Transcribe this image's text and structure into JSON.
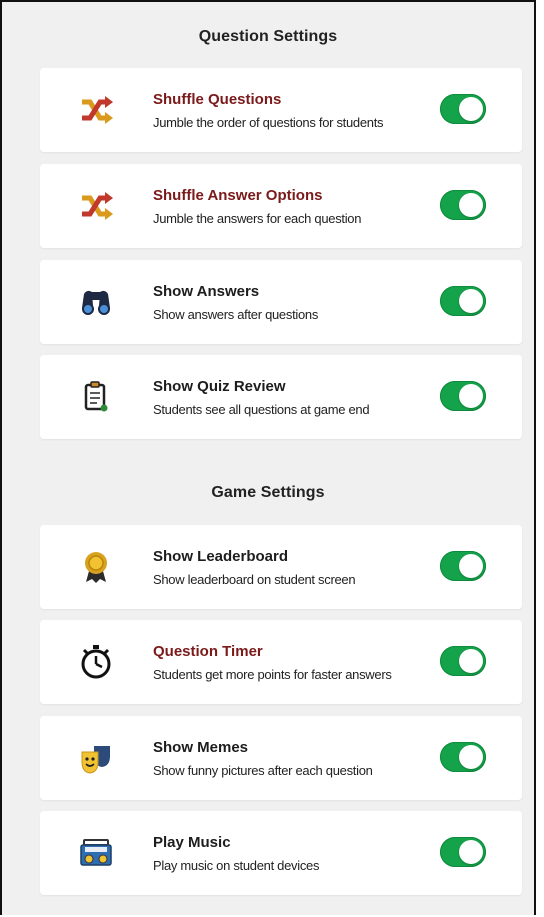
{
  "question_settings": {
    "title": "Question Settings",
    "items": [
      {
        "icon": "shuffle-icon",
        "title": "Shuffle Questions",
        "description": "Jumble the order of questions for students",
        "enabled": true
      },
      {
        "icon": "shuffle-icon",
        "title": "Shuffle Answer Options",
        "description": "Jumble the answers for each question",
        "enabled": true
      },
      {
        "icon": "binoculars-icon",
        "title": "Show Answers",
        "description": "Show answers after questions",
        "enabled": true
      },
      {
        "icon": "clipboard-icon",
        "title": "Show Quiz Review",
        "description": "Students see all questions at game end",
        "enabled": true
      }
    ]
  },
  "game_settings": {
    "title": "Game Settings",
    "items": [
      {
        "icon": "medal-icon",
        "title": "Show Leaderboard",
        "description": "Show leaderboard on student screen",
        "enabled": true
      },
      {
        "icon": "stopwatch-icon",
        "title": "Question Timer",
        "description": "Students get more points for faster answers",
        "enabled": true
      },
      {
        "icon": "theater-masks-icon",
        "title": "Show Memes",
        "description": "Show funny pictures after each question",
        "enabled": true
      },
      {
        "icon": "boombox-icon",
        "title": "Play Music",
        "description": "Play music on student devices",
        "enabled": true
      }
    ]
  },
  "colors": {
    "toggle_on": "#14a34a",
    "background": "#f0f0f0",
    "card": "#ffffff"
  }
}
